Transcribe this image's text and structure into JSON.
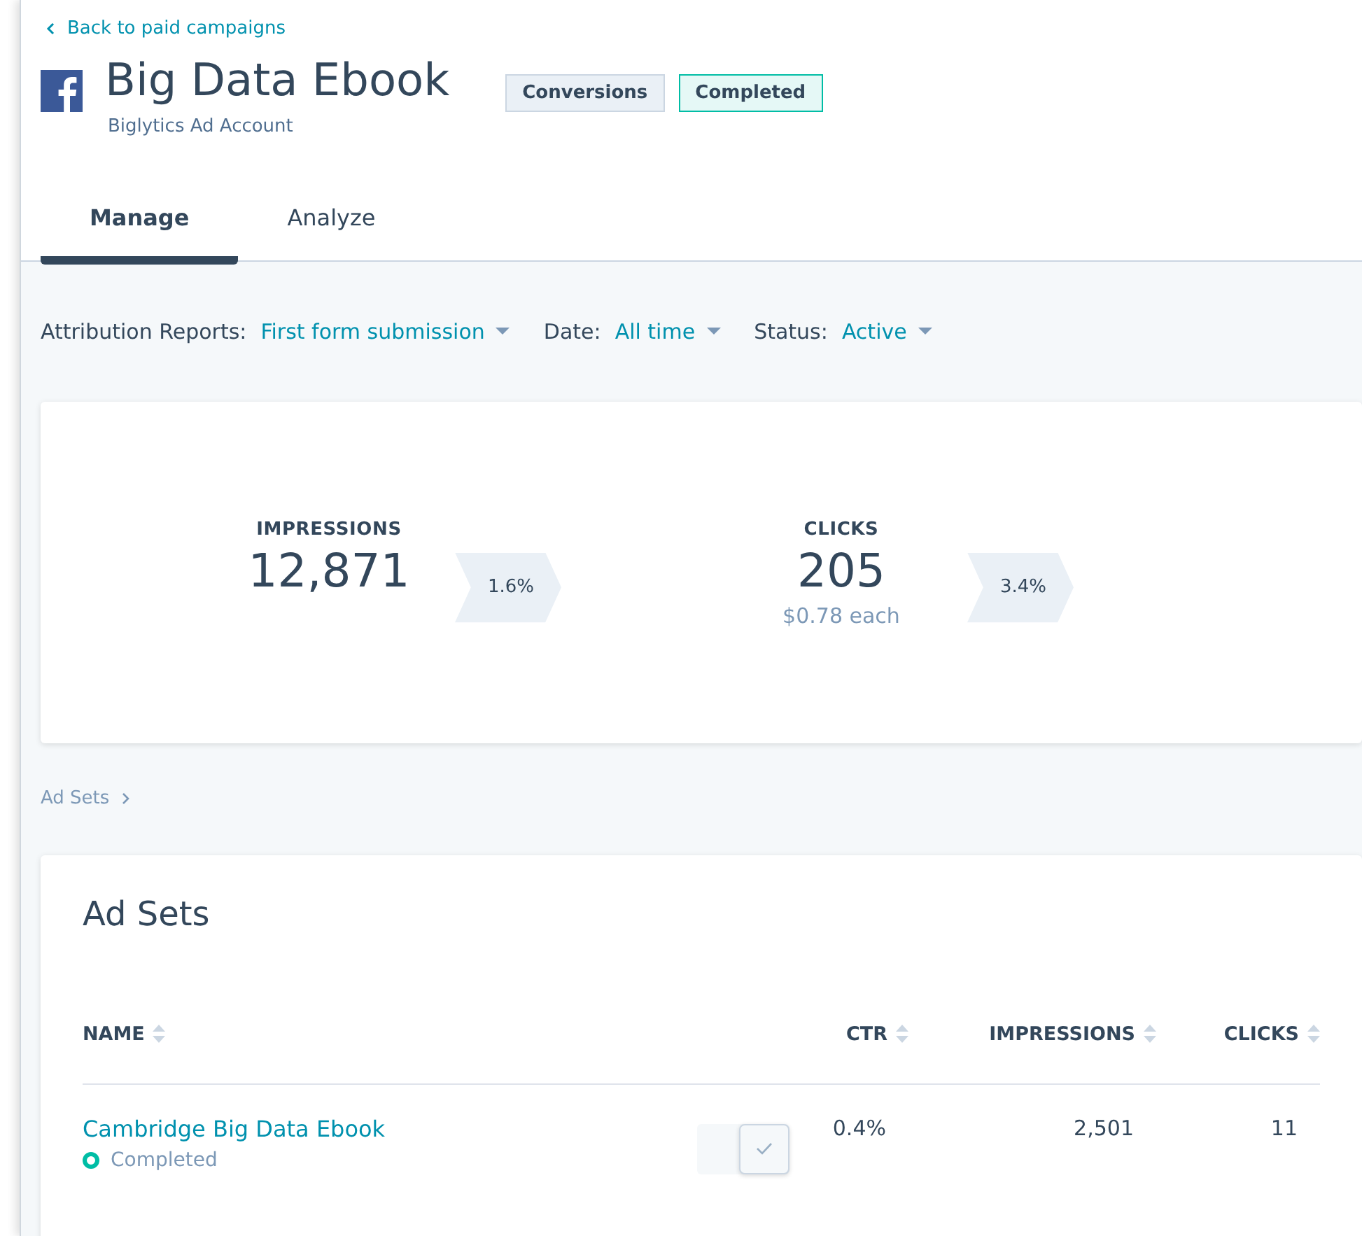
{
  "back_link": "Back to paid campaigns",
  "campaign": {
    "title": "Big Data Ebook",
    "account": "Biglytics Ad Account",
    "tags": [
      {
        "label": "Conversions",
        "kind": "neutral"
      },
      {
        "label": "Completed",
        "kind": "success"
      }
    ]
  },
  "tabs": [
    {
      "label": "Manage",
      "selected": true
    },
    {
      "label": "Analyze",
      "selected": false
    }
  ],
  "filters": [
    {
      "label": "Attribution Reports:",
      "value": "First form submission"
    },
    {
      "label": "Date:",
      "value": "All time"
    },
    {
      "label": "Status:",
      "value": "Active"
    }
  ],
  "funnel": [
    {
      "kind": "metric",
      "label": "IMPRESSIONS",
      "value": "12,871"
    },
    {
      "kind": "rate",
      "value": "1.6%"
    },
    {
      "kind": "metric",
      "label": "CLICKS",
      "value": "205",
      "note": "$0.78 each"
    },
    {
      "kind": "rate",
      "value": "3.4%"
    }
  ],
  "breadcrumb": "Ad Sets",
  "ad_sets": {
    "title": "Ad Sets",
    "columns": [
      {
        "label": "NAME"
      },
      {
        "label": "CTR"
      },
      {
        "label": "IMPRESSIONS"
      },
      {
        "label": "CLICKS"
      }
    ],
    "rows": [
      {
        "name": "Cambridge Big Data Ebook",
        "status": "Completed",
        "color": "#00bda5",
        "on": true,
        "ctr": "0.4%",
        "impressions": "2,501",
        "clicks": "11"
      }
    ]
  }
}
